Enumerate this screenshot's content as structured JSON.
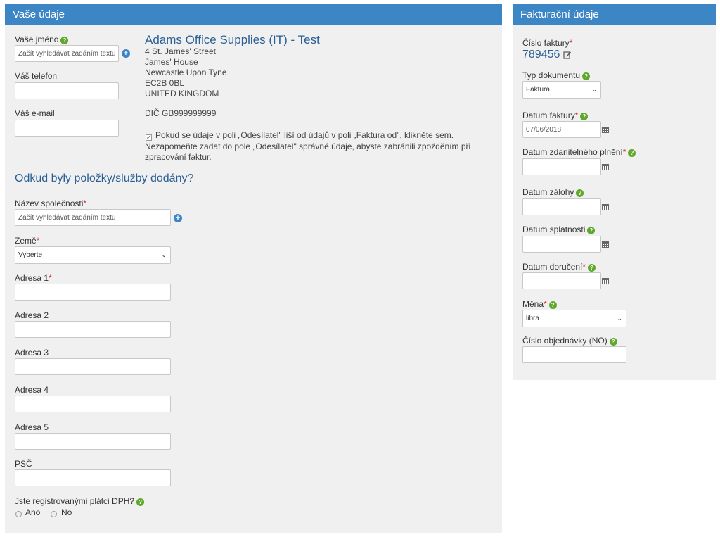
{
  "left_panel": {
    "header": "Vaše údaje",
    "your_name": {
      "label": "Vaše jméno",
      "placeholder": "Začít vyhledávat zadáním textu"
    },
    "your_phone": {
      "label": "Váš telefon",
      "value": ""
    },
    "your_email": {
      "label": "Váš e-mail",
      "value": ""
    },
    "company": {
      "name": "Adams Office Supplies (IT) - Test",
      "address_lines": [
        "4 St. James' Street",
        "James' House",
        "Newcastle Upon Tyne",
        "EC2B 0BL",
        "UNITED KINGDOM"
      ],
      "vat": "DIČ GB999999999"
    },
    "sender_notice": {
      "checked": true,
      "lines": [
        "Pokud se údaje v poli „Odesílatel\" liší od údajů v poli „Faktura od\", klikněte sem.",
        "Nezapomeňte zadat do pole „Odesílatel\" správné údaje, abyste zabránili zpožděním při",
        "zpracování faktur."
      ]
    },
    "delivery_section": {
      "title": "Odkud byly položky/služby dodány?",
      "company_name": {
        "label": "Název společnosti",
        "placeholder": "Začít vyhledávat zadáním textu"
      },
      "country": {
        "label": "Země",
        "selected": "Vyberte"
      },
      "address1": {
        "label": "Adresa 1",
        "value": ""
      },
      "address2": {
        "label": "Adresa 2",
        "value": ""
      },
      "address3": {
        "label": "Adresa 3",
        "value": ""
      },
      "address4": {
        "label": "Adresa 4",
        "value": ""
      },
      "address5": {
        "label": "Adresa 5",
        "value": ""
      },
      "postcode": {
        "label": "PSČ",
        "value": ""
      },
      "vat_question": {
        "label": "Jste registrovanými plátci DPH?",
        "yes": "Ano",
        "no": "No"
      }
    }
  },
  "right_panel": {
    "header": "Fakturační údaje",
    "invoice_number": {
      "label": "Číslo faktury",
      "value": "789456"
    },
    "document_type": {
      "label": "Typ dokumentu",
      "selected": "Faktura"
    },
    "invoice_date": {
      "label": "Datum faktury",
      "value": "07/06/2018"
    },
    "tax_date": {
      "label": "Datum zdanitelného plnění",
      "value": ""
    },
    "advance_date": {
      "label": "Datum zálohy",
      "value": ""
    },
    "due_date": {
      "label": "Datum splatnosti",
      "value": ""
    },
    "delivery_date": {
      "label": "Datum doručení",
      "value": ""
    },
    "currency": {
      "label": "Měna",
      "selected": "libra"
    },
    "po_number": {
      "label": "Číslo objednávky (NO)",
      "value": ""
    }
  },
  "icons": {
    "help": "question-circle-icon",
    "add": "plus-circle-icon",
    "calendar": "calendar-icon",
    "edit": "edit-icon",
    "dropdown": "chevron-down-icon"
  },
  "colors": {
    "header_bg": "#3d86c6",
    "panel_bg": "#f0f0f0",
    "title_blue": "#2b5f94",
    "required_red": "#d62c2c",
    "help_green": "#5fa82b"
  }
}
